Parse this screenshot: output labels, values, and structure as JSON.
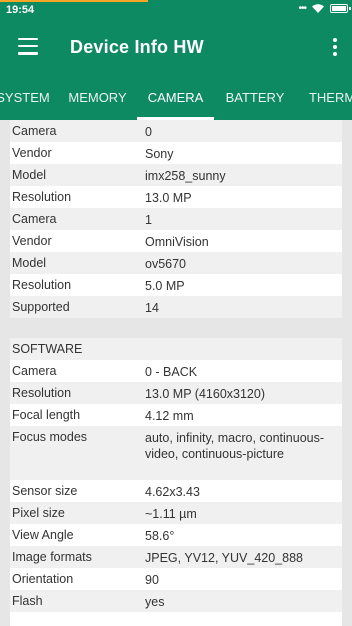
{
  "status_bar": {
    "time": "19:54",
    "battery_level": 0.85
  },
  "app_bar": {
    "title": "Device Info HW"
  },
  "tabs": [
    "SYSTEM",
    "MEMORY",
    "CAMERA",
    "BATTERY",
    "THERMAL"
  ],
  "active_tab": "CAMERA",
  "camera_rows": [
    {
      "key": "Camera",
      "value": "0"
    },
    {
      "key": "Vendor",
      "value": "Sony"
    },
    {
      "key": "Model",
      "value": "imx258_sunny"
    },
    {
      "key": "Resolution",
      "value": "13.0 MP"
    },
    {
      "key": "Camera",
      "value": "1"
    },
    {
      "key": "Vendor",
      "value": "OmniVision"
    },
    {
      "key": "Model",
      "value": "ov5670"
    },
    {
      "key": "Resolution",
      "value": "5.0 MP"
    },
    {
      "key": "Supported",
      "value": "14"
    }
  ],
  "software_heading": "SOFTWARE",
  "software_rows": [
    {
      "key": "Camera",
      "value": "0 - BACK"
    },
    {
      "key": "Resolution",
      "value": "13.0 MP (4160x3120)"
    },
    {
      "key": "Focal length",
      "value": "4.12 mm"
    },
    {
      "key": "Focus modes",
      "value": "auto, infinity, macro, continuous-video, continuous-picture"
    },
    {
      "key": "Sensor size",
      "value": "4.62x3.43"
    },
    {
      "key": "Pixel size",
      "value": "~1.11 µm"
    },
    {
      "key": "View Angle",
      "value": "58.6°"
    },
    {
      "key": "Image formats",
      "value": "JPEG, YV12, YUV_420_888"
    },
    {
      "key": "Orientation",
      "value": "90"
    },
    {
      "key": "Flash",
      "value": "yes"
    }
  ]
}
